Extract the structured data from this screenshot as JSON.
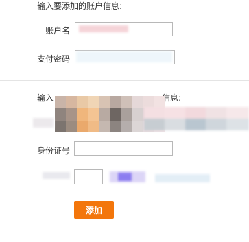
{
  "section1": {
    "title": "输入要添加的账户信息:",
    "account": {
      "label": "账户名",
      "value": ""
    },
    "password": {
      "label": "支付密码",
      "value": ""
    }
  },
  "section2": {
    "title_prefix": "输入",
    "title_suffix": "信息:",
    "id_number": {
      "label": "身份证号",
      "value": ""
    }
  },
  "actions": {
    "add_label": "添加"
  },
  "colors": {
    "accent": "#f3760b",
    "border": "#b8b8b8",
    "divider": "#e4e4e4",
    "text": "#333333"
  }
}
